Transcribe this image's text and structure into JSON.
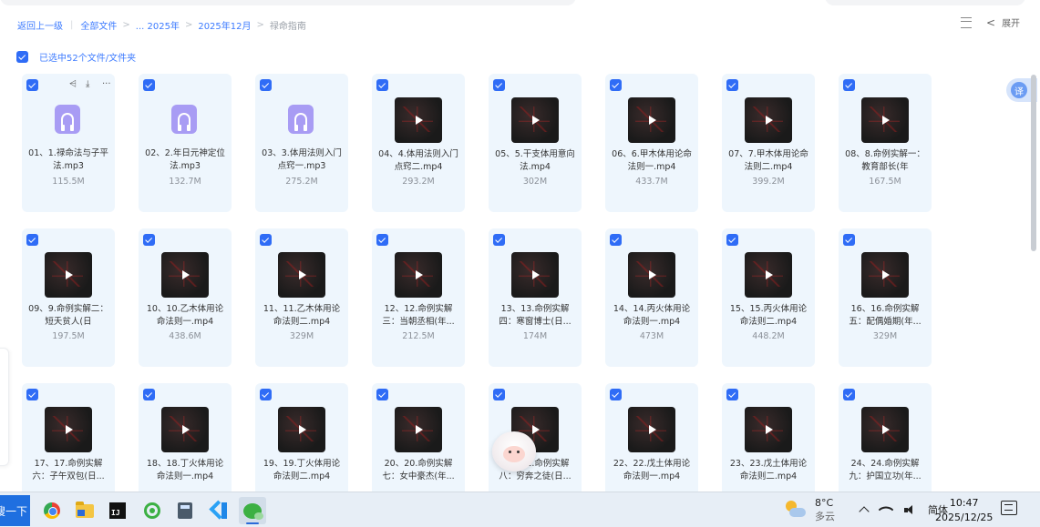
{
  "breadcrumb": {
    "back": "返回上一级",
    "all_files": "全部文件",
    "ellipsis_2025": "... 2025年",
    "month": "2025年12月",
    "current": "禄命指南"
  },
  "top_right": {
    "expand_label": "展开"
  },
  "selection": {
    "text": "已选中52个文件/文件夹"
  },
  "translate_label": "译",
  "files": [
    {
      "name": "01、1.禄命法与子平法.mp3",
      "size": "115.5M",
      "type": "audio"
    },
    {
      "name": "02、2.年日元神定位法.mp3",
      "size": "132.7M",
      "type": "audio"
    },
    {
      "name": "03、3.体用法则入门点窍一.mp3",
      "size": "275.2M",
      "type": "audio"
    },
    {
      "name": "04、4.体用法则入门点窍二.mp4",
      "size": "293.2M",
      "type": "video"
    },
    {
      "name": "05、5.干支体用意向法.mp4",
      "size": "302M",
      "type": "video"
    },
    {
      "name": "06、6.甲木体用论命法则一.mp4",
      "size": "433.7M",
      "type": "video"
    },
    {
      "name": "07、7.甲木体用论命法则二.mp4",
      "size": "399.2M",
      "type": "video"
    },
    {
      "name": "08、8.命例实解一：教育部长(年",
      "size": "167.5M",
      "type": "video"
    },
    {
      "name": "09、9.命例实解二：短夭贫人(日",
      "size": "197.5M",
      "type": "video"
    },
    {
      "name": "10、10.乙木体用论命法则一.mp4",
      "size": "438.6M",
      "type": "video"
    },
    {
      "name": "11、11.乙木体用论命法则二.mp4",
      "size": "329M",
      "type": "video"
    },
    {
      "name": "12、12.命例实解三：当朝丞相(年...",
      "size": "212.5M",
      "type": "video"
    },
    {
      "name": "13、13.命例实解四：寒窗博士(日...",
      "size": "174M",
      "type": "video"
    },
    {
      "name": "14、14.丙火体用论命法则一.mp4",
      "size": "473M",
      "type": "video"
    },
    {
      "name": "15、15.丙火体用论命法则二.mp4",
      "size": "448.2M",
      "type": "video"
    },
    {
      "name": "16、16.命例实解五：配偶婚期(年...",
      "size": "329M",
      "type": "video"
    },
    {
      "name": "17、17.命例实解六：子午双包(日...",
      "size": "",
      "type": "video"
    },
    {
      "name": "18、18.丁火体用论命法则一.mp4",
      "size": "",
      "type": "video"
    },
    {
      "name": "19、19.丁火体用论命法则二.mp4",
      "size": "",
      "type": "video"
    },
    {
      "name": "20、20.命例实解七：女中豪杰(年...",
      "size": "",
      "type": "video"
    },
    {
      "name": "21、21.命例实解八：穷奔之徒(日...",
      "size": "",
      "type": "video"
    },
    {
      "name": "22、22.戊土体用论命法则一.mp4",
      "size": "",
      "type": "video"
    },
    {
      "name": "23、23.戊土体用论命法则二.mp4",
      "size": "",
      "type": "video"
    },
    {
      "name": "24、24.命例实解九：护国立功(年...",
      "size": "",
      "type": "video"
    }
  ],
  "card_actions": [
    "share-icon",
    "download-icon",
    "more-icon"
  ],
  "taskbar": {
    "search_label": "搜一下",
    "weather_temp": "8°C",
    "weather_desc": "多云",
    "ime": "简体",
    "time": "10:47",
    "date": "2025/12/25"
  },
  "colors": {
    "accent": "#2f6cf6",
    "card_bg": "#eef6fd",
    "audio_icon": "#a89cf4",
    "taskbar_bg": "#e7eef6"
  }
}
